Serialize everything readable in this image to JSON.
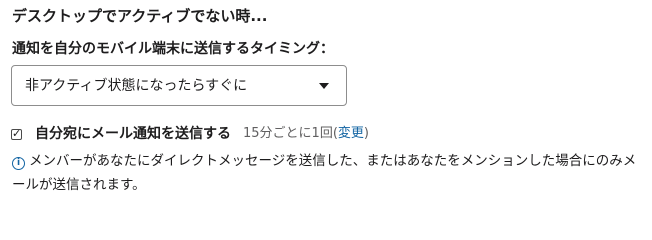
{
  "section": {
    "title": "デスクトップでアクティブでない時..."
  },
  "mobile_notification": {
    "label": "通知を自分のモバイル端末に送信するタイミング：",
    "selected": "非アクティブ状態になったらすぐに"
  },
  "email_notification": {
    "checked": true,
    "label": "自分宛にメール通知を送信する",
    "interval": "15分ごとに1回",
    "paren_open": " (",
    "change_link": "変更",
    "paren_close": ")"
  },
  "info": {
    "icon": "info-icon",
    "icon_glyph": "i",
    "text": "メンバーがあなたにダイレクトメッセージを送信した、またはあなたをメンションした場合にのみメールが送信されます。"
  },
  "colors": {
    "link": "#1264a3",
    "text": "#1d1c1d",
    "muted": "#616061",
    "border": "#8d8d8d"
  }
}
